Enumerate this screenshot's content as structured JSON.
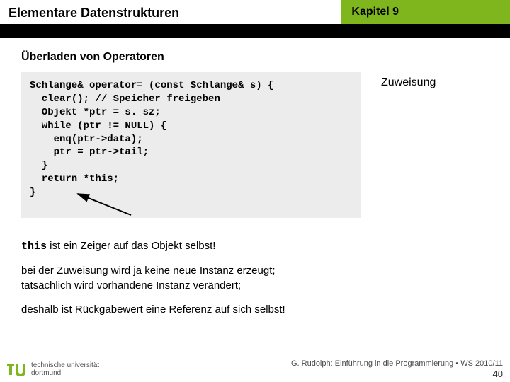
{
  "header": {
    "left_title": "Elementare Datenstrukturen",
    "right_title": "Kapitel 9"
  },
  "section_title": "Überladen von Operatoren",
  "code": "Schlange& operator= (const Schlange& s) {\n  clear(); // Speicher freigeben\n  Objekt *ptr = s. sz;\n  while (ptr != NULL) {\n    enq(ptr->data);\n    ptr = ptr->tail;\n  }\n  return *this;\n}",
  "side_label": "Zuweisung",
  "explain": {
    "p1_mono": "this",
    "p1_rest": " ist ein Zeiger auf das Objekt selbst!",
    "p2": "bei der Zuweisung wird ja keine neue Instanz erzeugt;\ntatsächlich wird vorhandene Instanz verändert;",
    "p3": "deshalb ist Rückgabewert eine Referenz auf sich selbst!"
  },
  "footer": {
    "logo_line1": "technische universität",
    "logo_line2": "dortmund",
    "credit": "G. Rudolph: Einführung in die Programmierung ▪ WS 2010/11",
    "page": "40"
  }
}
